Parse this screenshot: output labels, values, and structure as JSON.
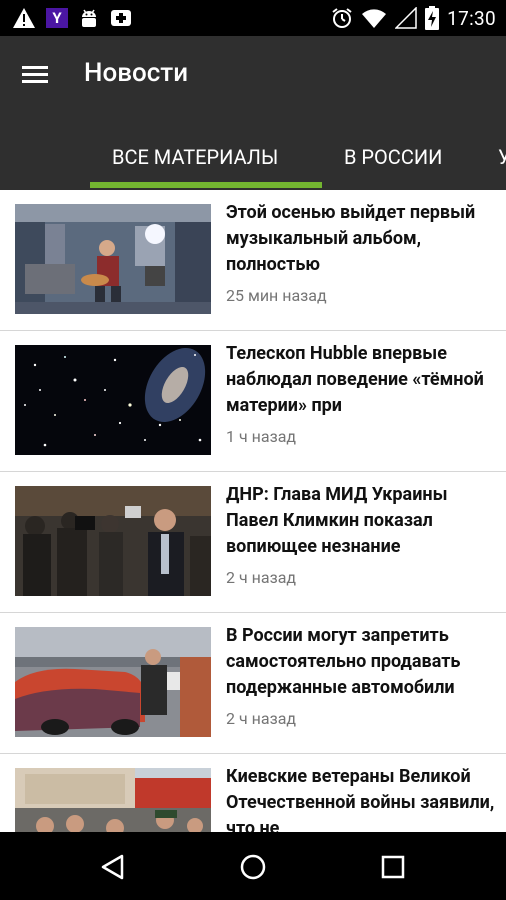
{
  "status_bar": {
    "time": "17:30",
    "left_icons": [
      "warning-icon",
      "yahoo-icon",
      "android-icon",
      "medical-plus-icon"
    ],
    "right_icons": [
      "alarm-icon",
      "wifi-icon",
      "signal-icon",
      "battery-charging-icon"
    ],
    "yahoo_letter": "Y"
  },
  "app_bar": {
    "title": "Новости",
    "tabs": [
      {
        "label": "ВСЕ МАТЕРИАЛЫ",
        "active": true
      },
      {
        "label": "В РОССИИ",
        "active": false
      },
      {
        "label": "У",
        "active": false
      }
    ],
    "accent_color": "#73b530"
  },
  "articles": [
    {
      "headline": "Этой осенью выйдет первый музыкальный альбом, полностью",
      "time": "25 мин назад",
      "image": "astronaut-guitar-space-station"
    },
    {
      "headline": "Телескоп Hubble впервые наблюдал поведение «тёмной материи» при",
      "time": "1 ч назад",
      "image": "galaxy-starfield"
    },
    {
      "headline": "ДНР: Глава МИД Украины Павел Климкин показал вопиющее незнание",
      "time": "2 ч назад",
      "image": "press-crowd-cameras"
    },
    {
      "headline": "В России могут запретить самостоятельно продавать подержанные автомобили",
      "time": "2 ч назад",
      "image": "used-car-lot"
    },
    {
      "headline": "Киевские ветераны Великой Отечественной войны заявили, что не",
      "time": "",
      "image": "veterans-parade"
    }
  ],
  "nav_bar": {
    "buttons": [
      "back-icon",
      "home-icon",
      "recents-icon"
    ]
  }
}
